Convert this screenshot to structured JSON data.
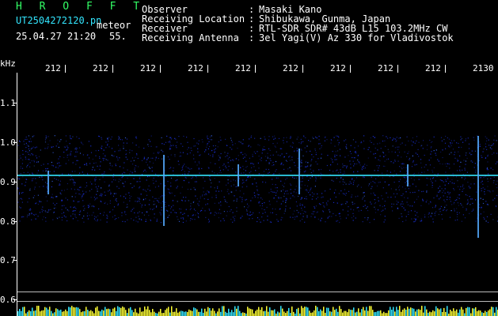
{
  "header": {
    "title": "H R O F F T",
    "filename": "UT2504272120.pn",
    "filename_suffix": "meteor",
    "datetime": "25.04.27 21:20",
    "minute_marker": "55.",
    "fields": [
      {
        "label": "Observer",
        "value": "Masaki Kano"
      },
      {
        "label": "Receiving Location",
        "value": "Shibukawa, Gunma, Japan"
      },
      {
        "label": "Receiver",
        "value": "RTL-SDR SDR# 43dB L15 103.2MHz CW"
      },
      {
        "label": "Receiving Antenna",
        "value": "3el Yagi(V) Az 330 for Vladivostok"
      }
    ],
    "separator": ":"
  },
  "axes": {
    "y_unit": "kHz",
    "y_ticks": [
      "1.1",
      "1.0",
      "0.9",
      "0.8",
      "0.7",
      "0.6"
    ],
    "x_ticks": [
      "212",
      "212",
      "212",
      "212",
      "212",
      "212",
      "212",
      "212",
      "212",
      "2130"
    ]
  },
  "colors": {
    "background": "#000000",
    "title": "#33ff66",
    "filename": "#33e6ff",
    "text": "#ffffff",
    "signal_noise": "#1a2fd6",
    "carrier": "#33e6ff",
    "activity_bar": "#ffff33"
  }
}
